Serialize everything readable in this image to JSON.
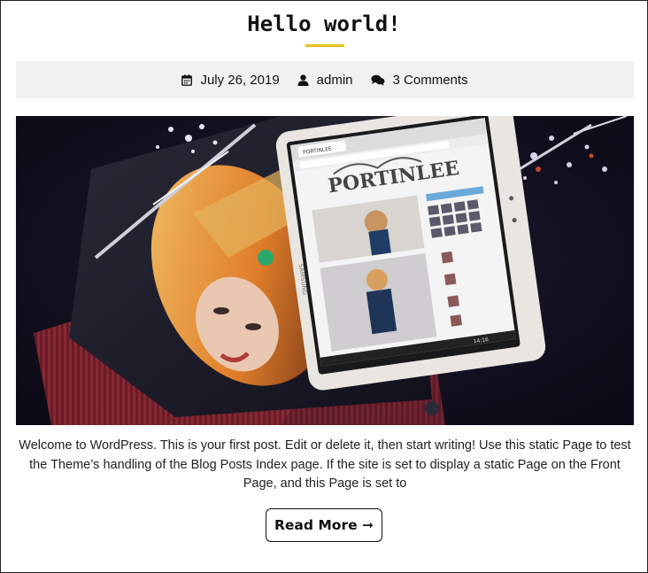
{
  "post": {
    "title": "Hello world!",
    "date": "July 26, 2019",
    "author": "admin",
    "comments": "3 Comments",
    "excerpt": "Welcome to WordPress. This is your first post. Edit or delete it, then start writing! Use this static Page to test the Theme’s handling of the Blog Posts Index page. If the site is set to display a static Page on the Front Page, and this Page is set to",
    "read_more": "Read More ➞"
  },
  "featured_image": {
    "blog_name": "PORTINLEE",
    "device_brand": "SAMSUNG",
    "tab_label": "PORTINLEE",
    "status_time": "14:16"
  },
  "colors": {
    "accent": "#e8c21a",
    "meta_background": "#f1f1f1",
    "text": "#111111"
  },
  "icons": [
    "calendar-icon",
    "user-icon",
    "comments-icon",
    "arrow-right-icon"
  ]
}
